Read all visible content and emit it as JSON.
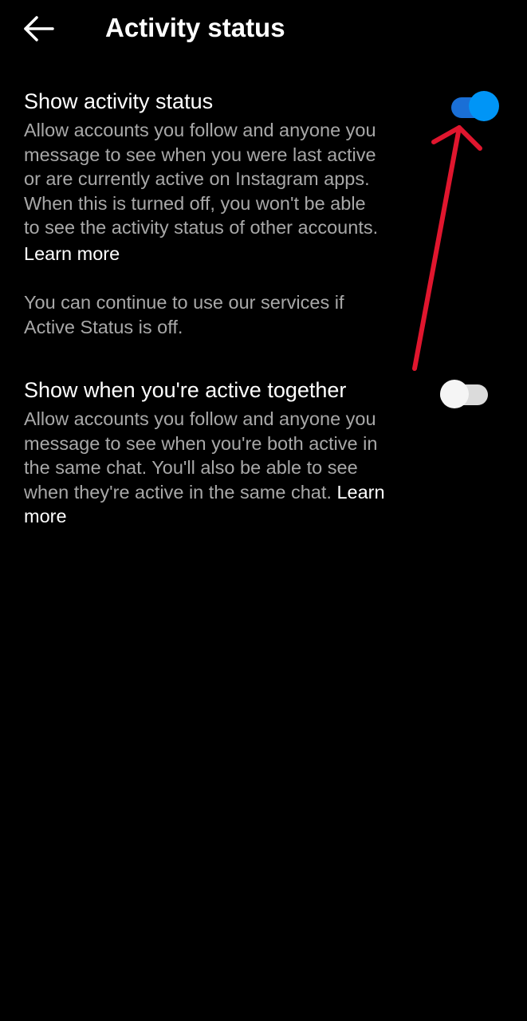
{
  "header": {
    "title": "Activity status",
    "back_icon": "arrow-left-icon"
  },
  "activity_status": {
    "title": "Show activity status",
    "description_lines": [
      "Allow accounts you follow and anyone you",
      "message to see when you were last active",
      "or are currently active on Instagram apps.",
      "When this is turned off, you won't be able",
      "to see the activity status of other accounts."
    ],
    "learn_more": "Learn more",
    "toggle_on": true,
    "note_lines": [
      "You can continue to use our services if",
      "Active Status is off."
    ]
  },
  "active_together": {
    "title": "Show when you're active together",
    "description_lines": [
      "Allow accounts you follow and anyone you",
      "message to see when you're both active in",
      "the same chat. You'll also be able to see",
      "when they're active in the same chat."
    ],
    "learn_more_part1": "Learn",
    "learn_more_part2": "more",
    "toggle_on": false
  },
  "colors": {
    "background": "#000000",
    "text_primary": "#ffffff",
    "text_secondary": "#a8a8a8",
    "toggle_on_track": "#1a6fd6",
    "toggle_on_knob": "#0095f6",
    "toggle_off_track": "#dbdbdb",
    "toggle_off_knob": "#f5f5f5",
    "annotation_arrow": "#e0162e"
  }
}
